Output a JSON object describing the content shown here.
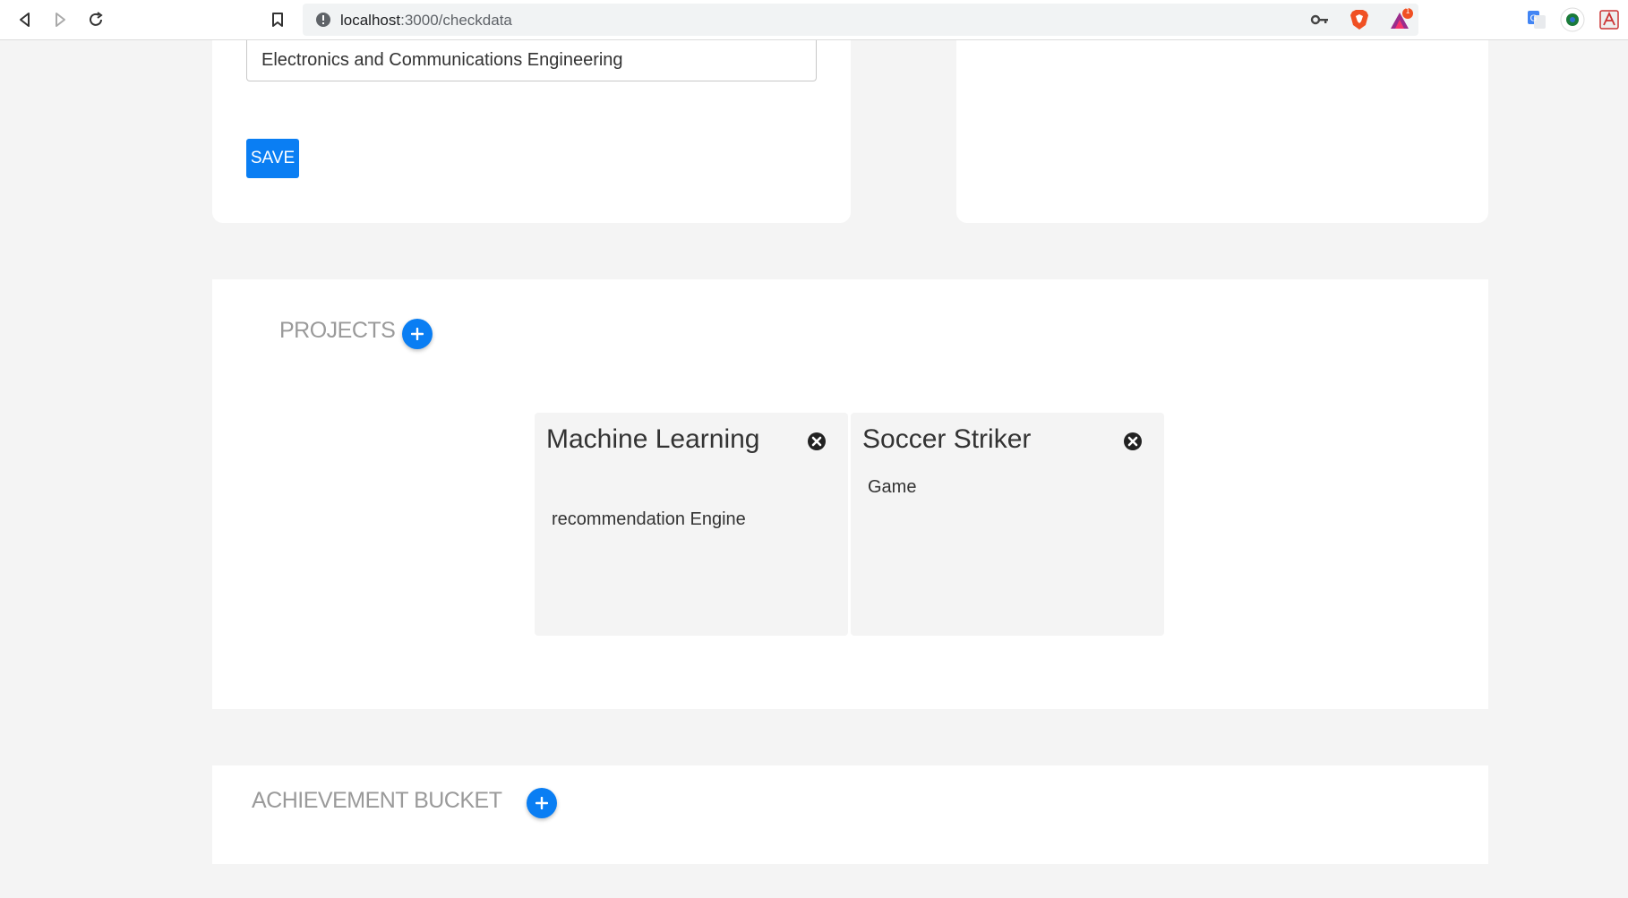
{
  "browser": {
    "url_host": "localhost",
    "url_path": ":3000/checkdata",
    "icons": {
      "back": "back-arrow-icon",
      "forward": "forward-arrow-icon",
      "reload": "reload-icon",
      "bookmark": "bookmark-icon",
      "site_info": "info-icon",
      "key": "key-icon",
      "brave": "brave-shield-icon",
      "rewards": "brave-rewards-icon",
      "translate": "translate-icon",
      "extension": "extension-circle-icon",
      "pdf": "pdf-icon"
    },
    "rewards_badge": "1"
  },
  "education": {
    "branch_value": "Electronics and Communications Engineering",
    "save_label": "SAVE"
  },
  "projects": {
    "title": "PROJECTS",
    "add_icon": "plus-icon",
    "items": [
      {
        "title": "Machine Learning",
        "description": "recommendation Engine"
      },
      {
        "title": "Soccer Striker",
        "description": "Game"
      }
    ]
  },
  "achievements": {
    "title": "ACHIEVEMENT BUCKET",
    "add_icon": "plus-icon"
  },
  "colors": {
    "accent": "#0a7ef3",
    "page_bg": "#f4f4f4",
    "card_bg": "#f4f4f4",
    "section_title": "#9a9a9a"
  }
}
